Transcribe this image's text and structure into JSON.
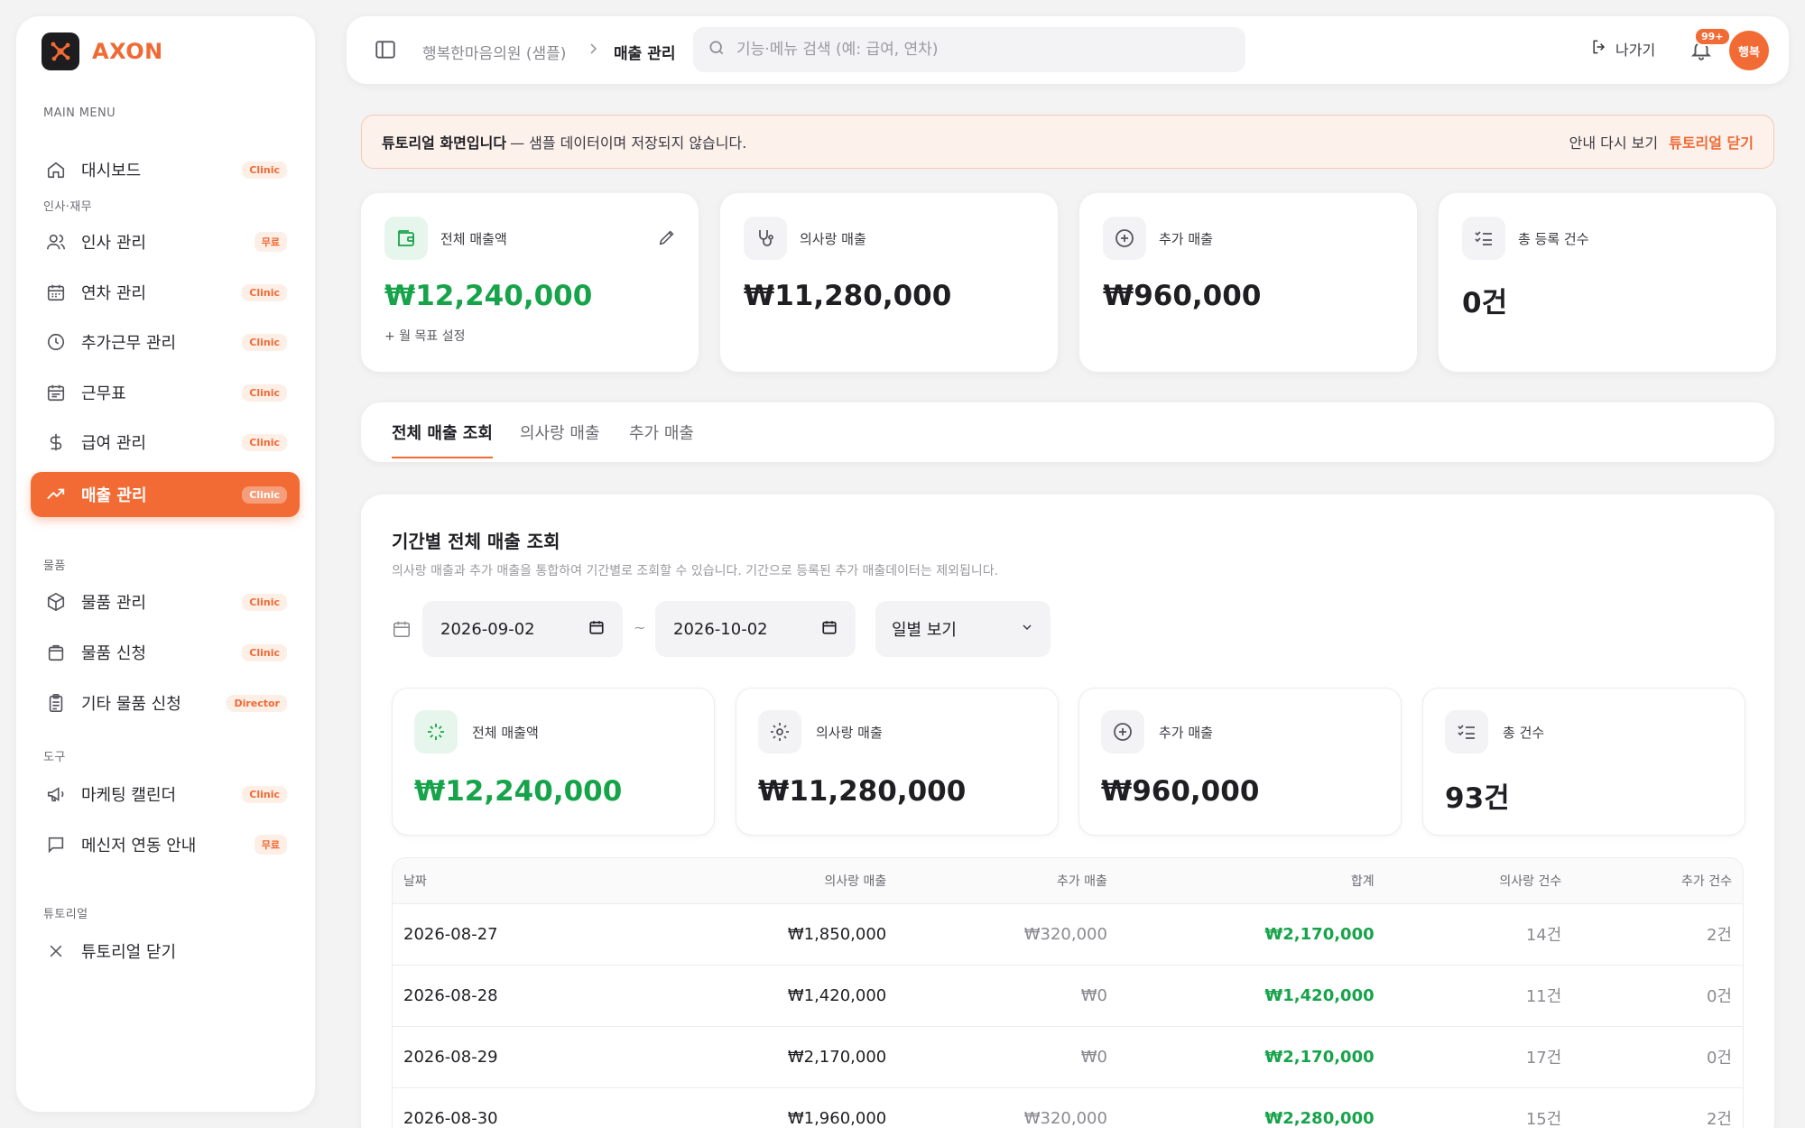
{
  "brand": {
    "name": "AXON"
  },
  "sidebar": {
    "sections": {
      "main": "MAIN MENU",
      "hr": "인사·재무",
      "goods": "물품",
      "tools": "도구",
      "tutorial": "튜토리얼"
    },
    "items": [
      {
        "label": "대시보드",
        "badge": "Clinic",
        "icon": "home-icon"
      },
      {
        "label": "인사 관리",
        "badge": "무료",
        "icon": "users-icon"
      },
      {
        "label": "연차 관리",
        "badge": "Clinic",
        "icon": "calendar-grid-icon"
      },
      {
        "label": "추가근무 관리",
        "badge": "Clinic",
        "icon": "clock-icon"
      },
      {
        "label": "근무표",
        "badge": "Clinic",
        "icon": "calendar-icon"
      },
      {
        "label": "급여 관리",
        "badge": "Clinic",
        "icon": "dollar-icon"
      },
      {
        "label": "매출 관리",
        "badge": "Clinic",
        "icon": "trending-up-icon"
      },
      {
        "label": "물품 관리",
        "badge": "Clinic",
        "icon": "box-icon"
      },
      {
        "label": "물품 신청",
        "badge": "Clinic",
        "icon": "shopping-bag-icon"
      },
      {
        "label": "기타 물품 신청",
        "badge": "Director",
        "icon": "clipboard-icon"
      },
      {
        "label": "마케팅 캘린더",
        "badge": "Clinic",
        "icon": "megaphone-icon"
      },
      {
        "label": "메신저 연동 안내",
        "badge": "무료",
        "icon": "message-icon"
      },
      {
        "label": "튜토리얼 닫기",
        "badge": "",
        "icon": "close-icon"
      }
    ]
  },
  "header": {
    "breadcrumb": [
      "행복한마음의원 (샘플)",
      "매출 관리"
    ],
    "search_placeholder": "기능·메뉴 검색 (예: 급여, 연차)",
    "exit_label": "나가기",
    "notification_count": "99+",
    "avatar_text": "행복"
  },
  "notice": {
    "strong": "튜토리얼 화면입니다",
    "rest": "— 샘플 데이터이며 저장되지 않습니다.",
    "again": "안내 다시 보기",
    "close": "튜토리얼 닫기"
  },
  "stats": [
    {
      "label": "전체 매출액",
      "value": "₩12,240,000",
      "goal": "+ 월 목표 설정"
    },
    {
      "label": "의사랑 매출",
      "value": "₩11,280,000"
    },
    {
      "label": "추가 매출",
      "value": "₩960,000"
    },
    {
      "label": "총 등록 건수",
      "value": "0건"
    }
  ],
  "tabs": [
    "전체 매출 조회",
    "의사랑 매출",
    "추가 매출"
  ],
  "panel": {
    "title": "기간별 전체 매출 조회",
    "desc": "의사랑 매출과 추가 매출을 통합하여 기간별로 조회할 수 있습니다. 기간으로 등록된 추가 매출데이터는 제외됩니다.",
    "date_from": "2026-09-02",
    "date_to": "2026-10-02",
    "tilde": "~",
    "view": "일별 보기"
  },
  "summary": [
    {
      "label": "전체 매출액",
      "value": "₩12,240,000"
    },
    {
      "label": "의사랑 매출",
      "value": "₩11,280,000"
    },
    {
      "label": "추가 매출",
      "value": "₩960,000"
    },
    {
      "label": "총 건수",
      "value": "93건"
    }
  ],
  "table": {
    "headers": [
      "날짜",
      "의사랑 매출",
      "추가 매출",
      "합계",
      "의사랑 건수",
      "추가 건수"
    ],
    "rows": [
      [
        "2026-08-27",
        "₩1,850,000",
        "₩320,000",
        "₩2,170,000",
        "14건",
        "2건"
      ],
      [
        "2026-08-28",
        "₩1,420,000",
        "₩0",
        "₩1,420,000",
        "11건",
        "0건"
      ],
      [
        "2026-08-29",
        "₩2,170,000",
        "₩0",
        "₩2,170,000",
        "17건",
        "0건"
      ],
      [
        "2026-08-30",
        "₩1,960,000",
        "₩320,000",
        "₩2,280,000",
        "15건",
        "2건"
      ]
    ]
  },
  "colors": {
    "accent": "#f26b35",
    "positive": "#17a34a"
  }
}
